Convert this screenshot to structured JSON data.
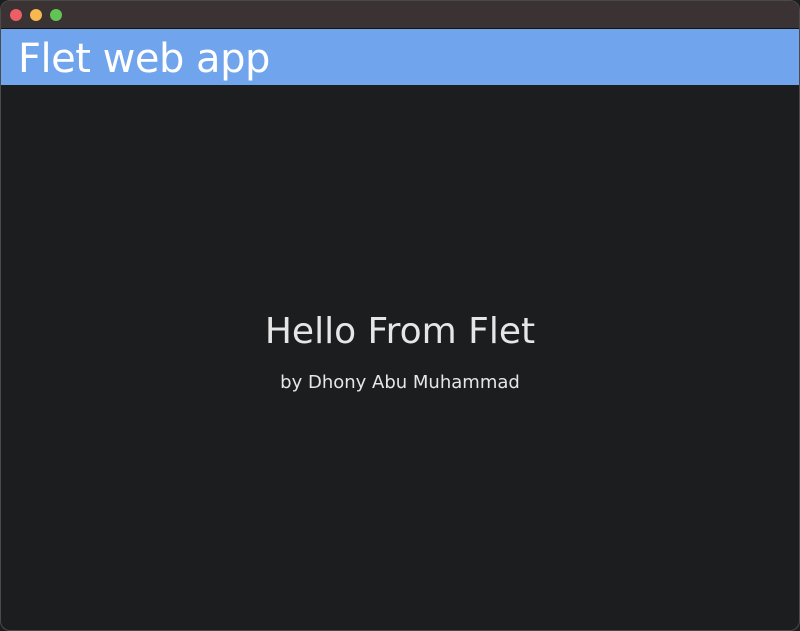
{
  "window": {
    "traffic_lights": {
      "close_color": "#ec5f67",
      "minimize_color": "#f5b94f",
      "zoom_color": "#61c454"
    }
  },
  "appbar": {
    "title": "Flet web app",
    "background_color": "#70a4ec"
  },
  "main": {
    "headline": "Hello From Flet",
    "byline": "by Dhony Abu Muhammad"
  }
}
